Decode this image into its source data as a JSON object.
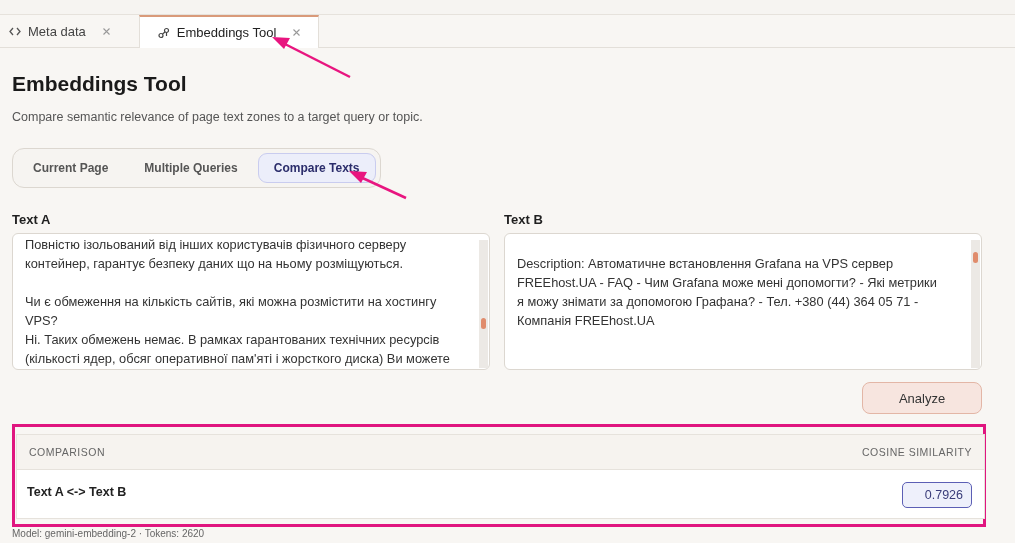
{
  "tabs": [
    {
      "label": "Meta data",
      "kind": "code",
      "selected": false
    },
    {
      "label": "Embeddings Tool",
      "kind": "nodes",
      "selected": true
    }
  ],
  "title": "Embeddings Tool",
  "subtitle": "Compare semantic relevance of page text zones to a target query or topic.",
  "modes": [
    {
      "label": "Current Page",
      "selected": false
    },
    {
      "label": "Multiple Queries",
      "selected": false
    },
    {
      "label": "Compare Texts",
      "selected": true
    }
  ],
  "inputs": [
    {
      "label": "Text A",
      "value": "Повністю ізольований від інших користувачів фізичного серверу контейнер, гарантує безпеку даних що на ньому розміщуються.\n\nЧи є обмеження на кількість сайтів, які можна розмістити на хостингу VPS?\nНі. Таких обмежень немає. В рамках гарантованих технічних ресурсів (кількості ядер, обсяг оперативної пам'яті і жорсткого диска) Ви можете"
    },
    {
      "label": "Text B",
      "value": "Description: Автоматичне встановлення Grafana на VPS сервер FREEhost.UA - FAQ - Чим Grafana може мені допомогти? - Які метрики я можу знімати за допомогою Графана? - Тел. +380 (44) 364 05 71 - Компанія FREEhost.UA"
    }
  ],
  "analyze_button": "Analyze",
  "results": {
    "columns": [
      "COMPARISON",
      "COSINE SIMILARITY"
    ],
    "rows": [
      {
        "comparison": "Text A <-> Text B",
        "similarity": "0.7926"
      }
    ]
  },
  "footer": "Model: gemini-embedding-2 · Tokens: 2620"
}
